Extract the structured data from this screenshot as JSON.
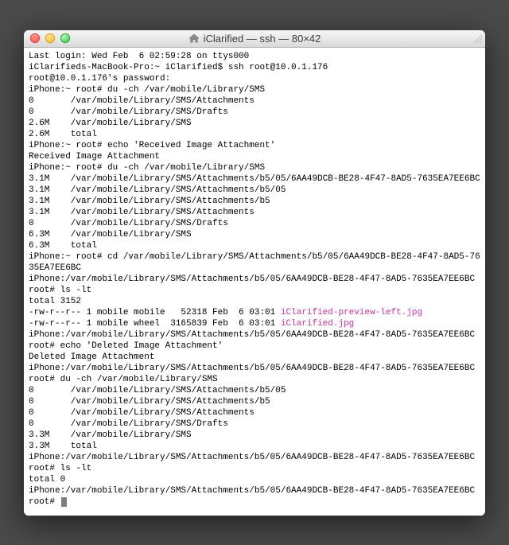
{
  "titlebar": {
    "icon": "home-icon",
    "title": "iClarified — ssh — 80×42"
  },
  "lines": [
    {
      "t": "Last login: Wed Feb  6 02:59:28 on ttys000"
    },
    {
      "t": "iClarifieds-MacBook-Pro:~ iClarified$ ssh root@10.0.1.176"
    },
    {
      "t": "root@10.0.1.176's password:"
    },
    {
      "t": "iPhone:~ root# du -ch /var/mobile/Library/SMS"
    },
    {
      "t": "0       /var/mobile/Library/SMS/Attachments"
    },
    {
      "t": "0       /var/mobile/Library/SMS/Drafts"
    },
    {
      "t": "2.6M    /var/mobile/Library/SMS"
    },
    {
      "t": "2.6M    total"
    },
    {
      "t": "iPhone:~ root# echo 'Received Image Attachment'"
    },
    {
      "t": "Received Image Attachment"
    },
    {
      "t": "iPhone:~ root# du -ch /var/mobile/Library/SMS"
    },
    {
      "t": "3.1M    /var/mobile/Library/SMS/Attachments/b5/05/6AA49DCB-BE28-4F47-8AD5-7635EA7EE6BC"
    },
    {
      "t": "3.1M    /var/mobile/Library/SMS/Attachments/b5/05"
    },
    {
      "t": "3.1M    /var/mobile/Library/SMS/Attachments/b5"
    },
    {
      "t": "3.1M    /var/mobile/Library/SMS/Attachments"
    },
    {
      "t": "0       /var/mobile/Library/SMS/Drafts"
    },
    {
      "t": "6.3M    /var/mobile/Library/SMS"
    },
    {
      "t": "6.3M    total"
    },
    {
      "t": "iPhone:~ root# cd /var/mobile/Library/SMS/Attachments/b5/05/6AA49DCB-BE28-4F47-8AD5-7635EA7EE6BC"
    },
    {
      "t": "iPhone:/var/mobile/Library/SMS/Attachments/b5/05/6AA49DCB-BE28-4F47-8AD5-7635EA7EE6BC root# ls -lt"
    },
    {
      "t": "total 3152"
    },
    {
      "parts": [
        {
          "t": "-rw-r--r-- 1 mobile mobile   52318 Feb  6 03:01 "
        },
        {
          "t": "iClarified-preview-left.jpg",
          "c": "magenta"
        }
      ]
    },
    {
      "parts": [
        {
          "t": "-rw-r--r-- 1 mobile wheel  3165839 Feb  6 03:01 "
        },
        {
          "t": "iClarified.jpg",
          "c": "magenta"
        }
      ]
    },
    {
      "t": "iPhone:/var/mobile/Library/SMS/Attachments/b5/05/6AA49DCB-BE28-4F47-8AD5-7635EA7EE6BC root# echo 'Deleted Image Attachment'"
    },
    {
      "t": "Deleted Image Attachment"
    },
    {
      "t": "iPhone:/var/mobile/Library/SMS/Attachments/b5/05/6AA49DCB-BE28-4F47-8AD5-7635EA7EE6BC root# du -ch /var/mobile/Library/SMS"
    },
    {
      "t": "0       /var/mobile/Library/SMS/Attachments/b5/05"
    },
    {
      "t": "0       /var/mobile/Library/SMS/Attachments/b5"
    },
    {
      "t": "0       /var/mobile/Library/SMS/Attachments"
    },
    {
      "t": "0       /var/mobile/Library/SMS/Drafts"
    },
    {
      "t": "3.3M    /var/mobile/Library/SMS"
    },
    {
      "t": "3.3M    total"
    },
    {
      "t": "iPhone:/var/mobile/Library/SMS/Attachments/b5/05/6AA49DCB-BE28-4F47-8AD5-7635EA7EE6BC root# ls -lt"
    },
    {
      "t": "total 0"
    },
    {
      "t": "iPhone:/var/mobile/Library/SMS/Attachments/b5/05/6AA49DCB-BE28-4F47-8AD5-7635EA7EE6BC root# ",
      "cursor": true
    }
  ]
}
